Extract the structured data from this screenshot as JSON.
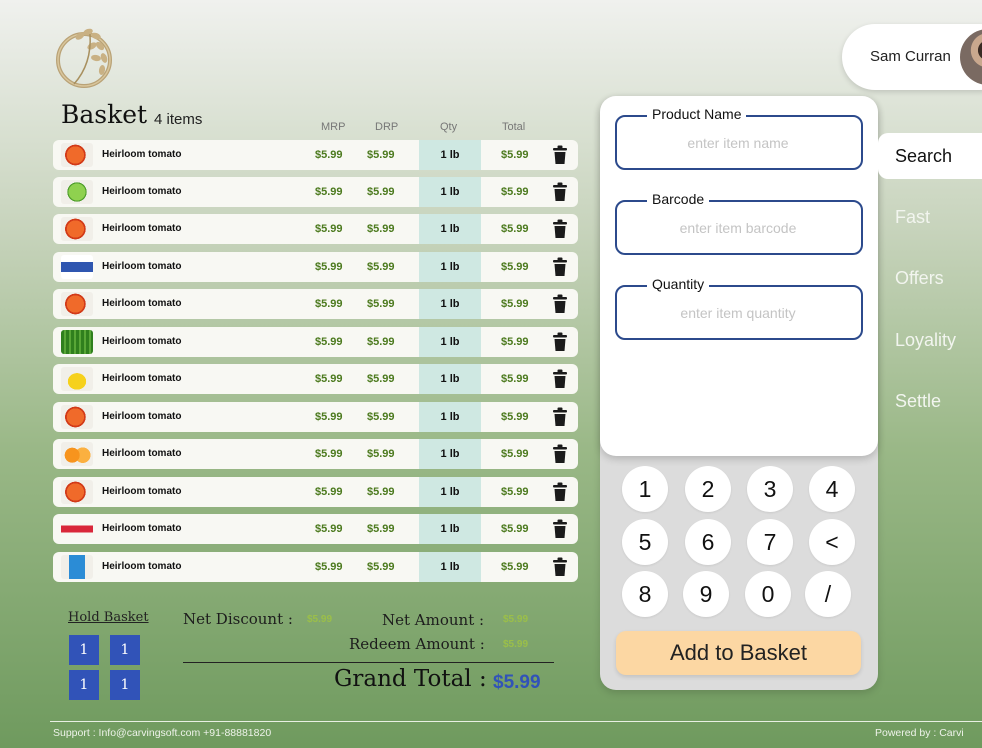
{
  "user": {
    "name": "Sam Curran"
  },
  "basket": {
    "title": "Basket",
    "count": "4 items",
    "columns": {
      "mrp": "MRP",
      "drp": "DRP",
      "qty": "Qty",
      "total": "Total"
    },
    "items": [
      {
        "name": "Heirloom tomato",
        "mrp": "$5.99",
        "drp": "$5.99",
        "qty": "1 lb",
        "total": "$5.99",
        "icon": "tomato-icon"
      },
      {
        "name": "Heirloom tomato",
        "mrp": "$5.99",
        "drp": "$5.99",
        "qty": "1 lb",
        "total": "$5.99",
        "icon": "lettuce-icon"
      },
      {
        "name": "Heirloom tomato",
        "mrp": "$5.99",
        "drp": "$5.99",
        "qty": "1 lb",
        "total": "$5.99",
        "icon": "tomato-icon"
      },
      {
        "name": "Heirloom tomato",
        "mrp": "$5.99",
        "drp": "$5.99",
        "qty": "1 lb",
        "total": "$5.99",
        "icon": "milk-pack-icon"
      },
      {
        "name": "Heirloom tomato",
        "mrp": "$5.99",
        "drp": "$5.99",
        "qty": "1 lb",
        "total": "$5.99",
        "icon": "tomato-icon"
      },
      {
        "name": "Heirloom tomato",
        "mrp": "$5.99",
        "drp": "$5.99",
        "qty": "1 lb",
        "total": "$5.99",
        "icon": "green-beans-icon"
      },
      {
        "name": "Heirloom tomato",
        "mrp": "$5.99",
        "drp": "$5.99",
        "qty": "1 lb",
        "total": "$5.99",
        "icon": "banana-icon"
      },
      {
        "name": "Heirloom tomato",
        "mrp": "$5.99",
        "drp": "$5.99",
        "qty": "1 lb",
        "total": "$5.99",
        "icon": "tomato-icon"
      },
      {
        "name": "Heirloom tomato",
        "mrp": "$5.99",
        "drp": "$5.99",
        "qty": "1 lb",
        "total": "$5.99",
        "icon": "orange-icon"
      },
      {
        "name": "Heirloom tomato",
        "mrp": "$5.99",
        "drp": "$5.99",
        "qty": "1 lb",
        "total": "$5.99",
        "icon": "tomato-icon"
      },
      {
        "name": "Heirloom tomato",
        "mrp": "$5.99",
        "drp": "$5.99",
        "qty": "1 lb",
        "total": "$5.99",
        "icon": "toothpaste-icon"
      },
      {
        "name": "Heirloom tomato",
        "mrp": "$5.99",
        "drp": "$5.99",
        "qty": "1 lb",
        "total": "$5.99",
        "icon": "soap-pack-icon"
      }
    ]
  },
  "hold": {
    "label": "Hold Basket",
    "buttons": [
      "1",
      "1",
      "1",
      "1"
    ]
  },
  "summary": {
    "net_discount_label": "Net Discount :",
    "net_discount": "$5.99",
    "net_amount_label": "Net Amount :",
    "net_amount": "$5.99",
    "redeem_label": "Redeem Amount :",
    "redeem": "$5.99",
    "grand_total_label": "Grand Total :",
    "grand_total": "$5.99"
  },
  "form": {
    "product_label": "Product Name",
    "product_placeholder": "enter item name",
    "barcode_label": "Barcode",
    "barcode_placeholder": "enter item barcode",
    "quantity_label": "Quantity",
    "quantity_placeholder": "enter item quantity"
  },
  "keypad": [
    "1",
    "2",
    "3",
    "4",
    "5",
    "6",
    "7",
    "<",
    "8",
    "9",
    "0",
    "/"
  ],
  "add_button": "Add to Basket",
  "tabs": {
    "search": "Search",
    "fast": "Fast",
    "offers": "Offers",
    "loyalty": "Loyality",
    "settle": "Settle"
  },
  "footer": {
    "support": "Support : Info@carvingsoft.com  +91-88881820",
    "powered": "Powered by : Carvi"
  },
  "colors": {
    "price_green": "#4c7a1e",
    "accent_blue": "#3153b8",
    "qty_bg": "#cfe8e2",
    "add_button": "#fcd7a3",
    "field_border": "#2c4a8c"
  }
}
